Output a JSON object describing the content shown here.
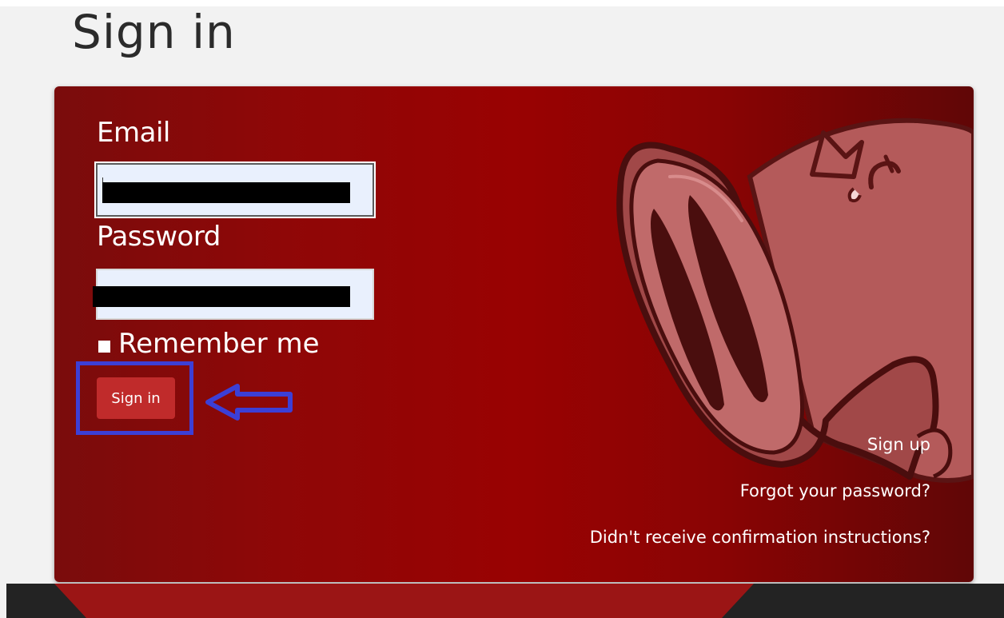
{
  "page": {
    "title": "Sign in"
  },
  "form": {
    "email_label": "Email",
    "password_label": "Password",
    "remember_label": "Remember me",
    "submit_label": "Sign in"
  },
  "links": {
    "sign_up": "Sign up",
    "forgot_password": "Forgot your password?",
    "confirmation": "Didn't receive confirmation instructions?"
  },
  "colors": {
    "panel": "#990202",
    "button": "#c02b2b",
    "annotation": "#3c3fd6",
    "footer": "#232323"
  },
  "icons": {
    "annotation": "left-arrow-icon",
    "illustration": "pig-snout-illustration"
  }
}
